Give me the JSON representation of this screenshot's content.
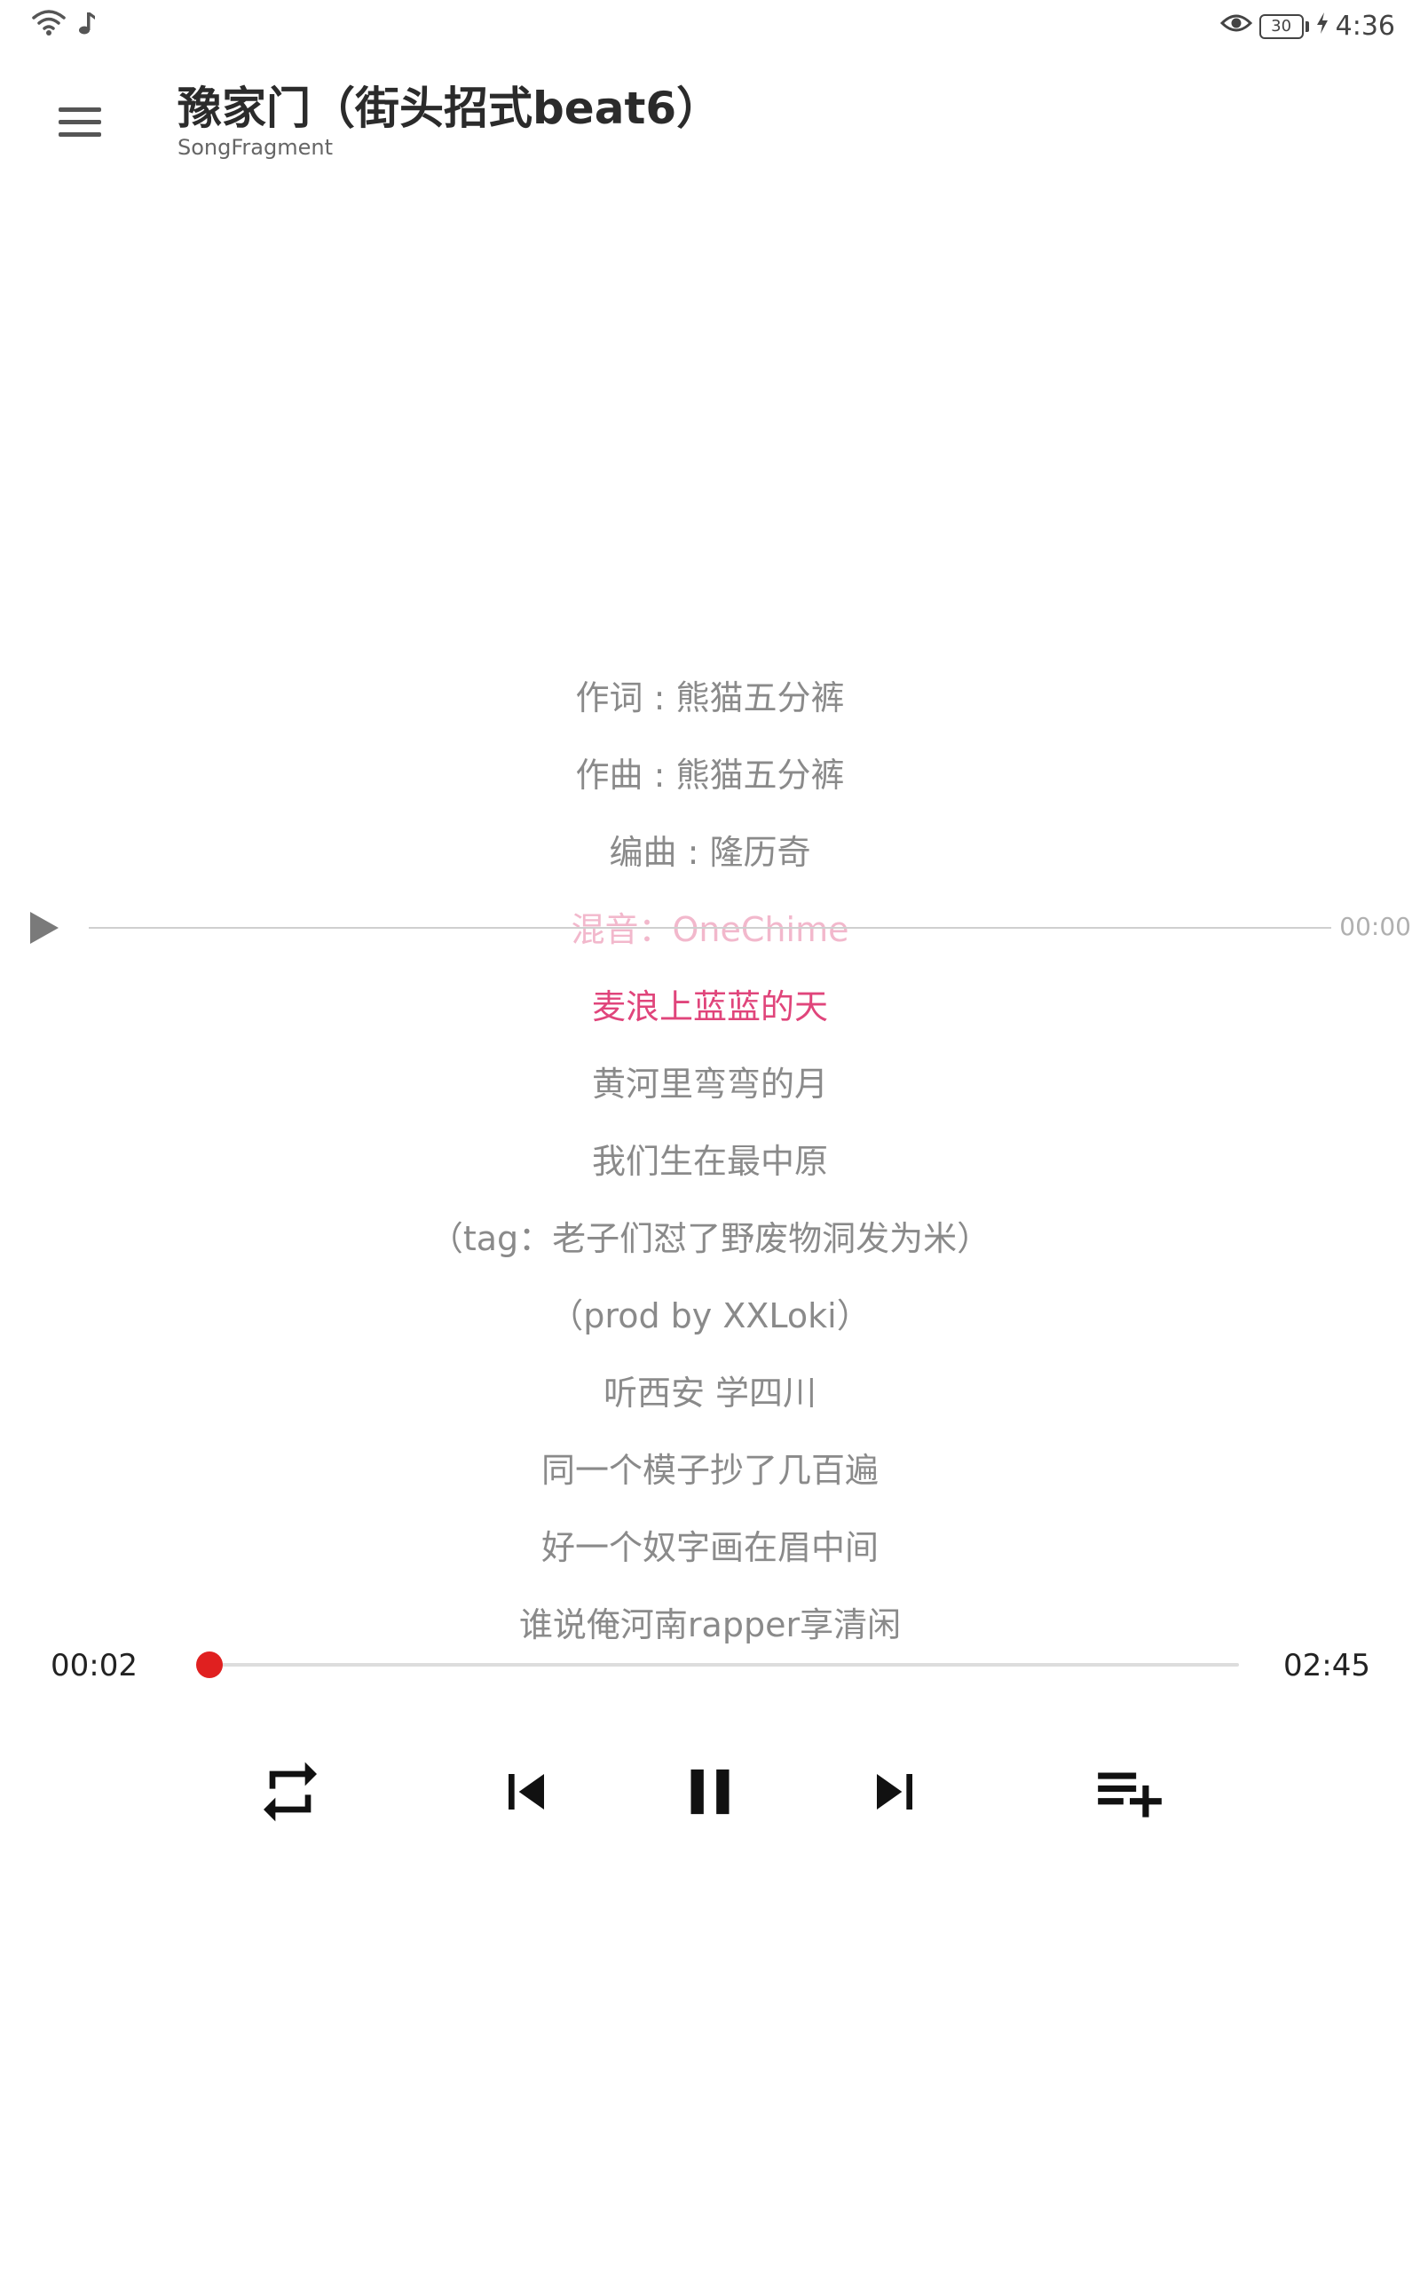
{
  "status_bar": {
    "left_icons": [
      "wifi-icon",
      "music-note-icon"
    ],
    "right_icons": [
      "eye-icon",
      "battery-icon",
      "charging-bolt-icon"
    ],
    "battery_level": "30",
    "time": "4:36"
  },
  "app_bar": {
    "menu_icon": "menu-icon",
    "title": "豫家门（街头招式beat6）",
    "subtitle": "SongFragment"
  },
  "lyrics": {
    "lines": [
      "作词 : 熊猫五分裤",
      "作曲 : 熊猫五分裤",
      "编曲 : 隆历奇",
      "混音：OneChime",
      "麦浪上蓝蓝的天",
      "黄河里弯弯的月",
      "我们生在最中原",
      "（tag：老子们怼了野废物洞发为米）",
      "（prod by XXLoki）",
      "听西安 学四川",
      "同一个模子抄了几百遍",
      "好一个奴字画在眉中间",
      "谁说俺河南rapper享清闲"
    ],
    "faded_index": 3,
    "current_index": 4,
    "faded_color": "#f2b8cc",
    "current_color": "#e0457b",
    "normal_color": "#8a8a8a"
  },
  "lyric_seek": {
    "play_icon": "play-icon",
    "time": "00:00"
  },
  "playback": {
    "current_time": "00:02",
    "total_time": "02:45",
    "progress": 0.012,
    "accent_color": "#e02020"
  },
  "controls": {
    "repeat_icon": "repeat-icon",
    "previous_icon": "skip-previous-icon",
    "play_pause_icon": "pause-icon",
    "next_icon": "skip-next-icon",
    "playlist_add_icon": "playlist-add-icon"
  }
}
